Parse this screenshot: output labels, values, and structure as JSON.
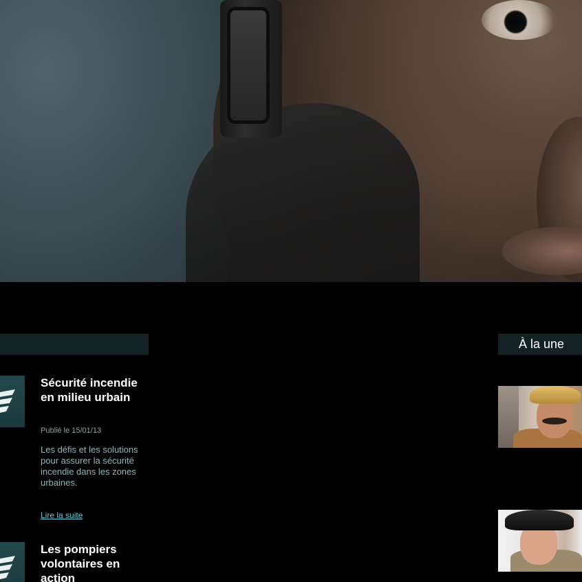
{
  "hero": {
    "image": "firefighter-closeup-photo"
  },
  "articles": [
    {
      "title": "Sécurité incendie en milieu urbain",
      "date": "Publié le 15/01/13",
      "description": "Les défis et les solutions pour assurer la sécurité incendie dans les zones urbaines.",
      "read_more": "Lire la suite"
    },
    {
      "title": "Les pompiers volontaires en action"
    }
  ],
  "sidebar": {
    "heading": "À la une",
    "items": [
      {
        "image": "smiling-firefighter-with-mustache-photo"
      },
      {
        "image": "young-firefighter-helmet-photo"
      }
    ]
  },
  "colors": {
    "background": "#000000",
    "header_bar": "#132325",
    "link": "#5fd2e6",
    "text_muted": "#8fb9bc"
  }
}
